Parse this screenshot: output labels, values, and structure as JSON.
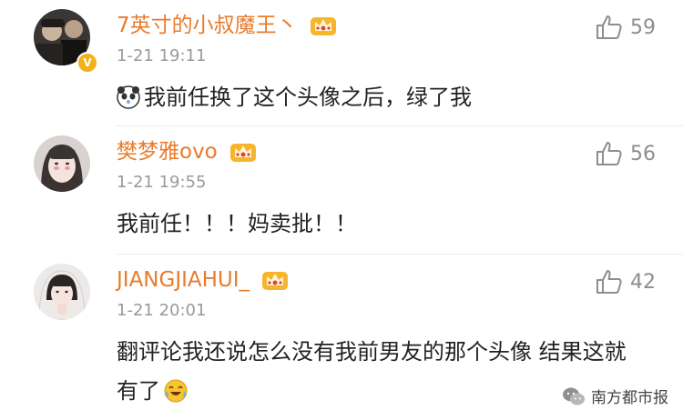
{
  "comments": [
    {
      "username": "7英寸的小叔魔王丶",
      "time": "1-21 19:11",
      "likes": "59",
      "text": "我前任换了这个头像之后，绿了我",
      "avatar_icon": "avatar-dark-photo",
      "verified": true,
      "emoji": "panda-emoji"
    },
    {
      "username": "樊梦雅ovo",
      "time": "1-21 19:55",
      "likes": "56",
      "text": "我前任！！！妈卖批！！",
      "avatar_icon": "avatar-girl-photo"
    },
    {
      "username": "JIANGJIAHUI_",
      "time": "1-21 20:01",
      "likes": "42",
      "text": "翻评论我还说怎么没有我前男友的那个头像 结果这就有了",
      "avatar_icon": "avatar-girl-photo",
      "emoji": "laugh-cry-emoji"
    }
  ],
  "watermark": {
    "text": "南方都市报"
  },
  "colors": {
    "username": "#e97b2b",
    "time": "#9a9a9a",
    "likes": "#8e8e8e"
  }
}
